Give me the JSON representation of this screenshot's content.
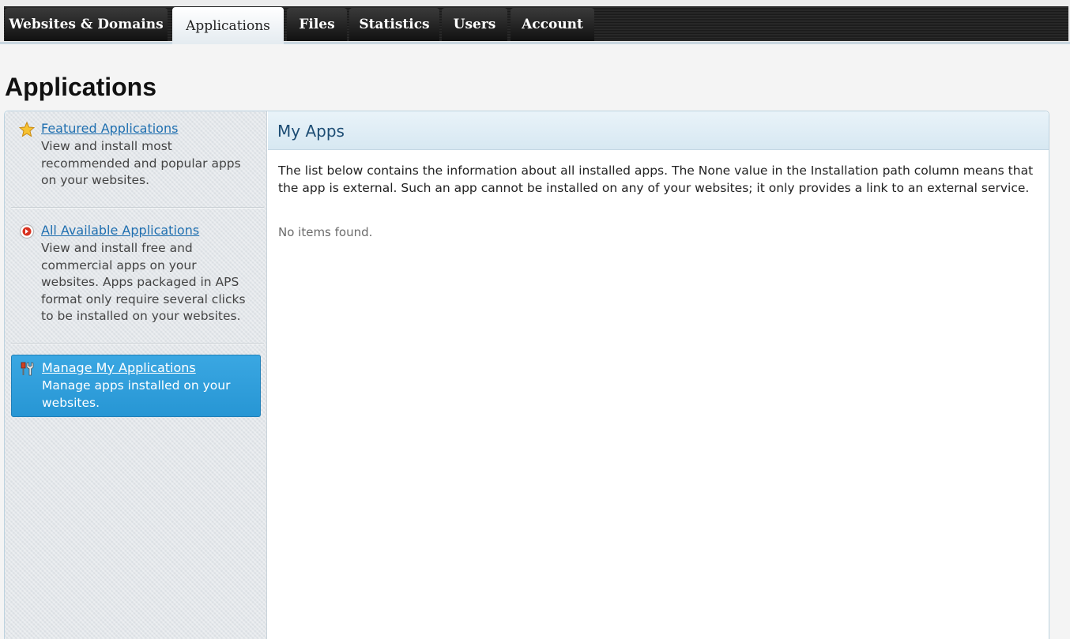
{
  "tabs": [
    {
      "label": "Websites & Domains",
      "active": false
    },
    {
      "label": "Applications",
      "active": true
    },
    {
      "label": "Files",
      "active": false
    },
    {
      "label": "Statistics",
      "active": false
    },
    {
      "label": "Users",
      "active": false
    },
    {
      "label": "Account",
      "active": false
    }
  ],
  "page_title": "Applications",
  "sidebar": {
    "items": [
      {
        "icon": "star-icon",
        "label": "Featured Applications",
        "description": "View and install most recommended and popular apps on your websites.",
        "active": false
      },
      {
        "icon": "app-catalog-icon",
        "label": "All Available Applications",
        "description": "View and install free and commercial apps on your websites. Apps packaged in APS format only require several clicks to be installed on your websites.",
        "active": false
      },
      {
        "icon": "tools-icon",
        "label": "Manage My Applications",
        "description": "Manage apps installed on your websites.",
        "active": true
      }
    ]
  },
  "main": {
    "title": "My Apps",
    "description": "The list below contains the information about all installed apps. The None value in the Installation path column means that the app is external. Such an app cannot be installed on any of your websites; it only provides a link to an external service.",
    "empty_message": "No items found."
  },
  "colors": {
    "link": "#1f6fb0",
    "active_item": "#2d9ad8",
    "panel_header": "#ddebf4",
    "title_text": "#1d4d74"
  }
}
